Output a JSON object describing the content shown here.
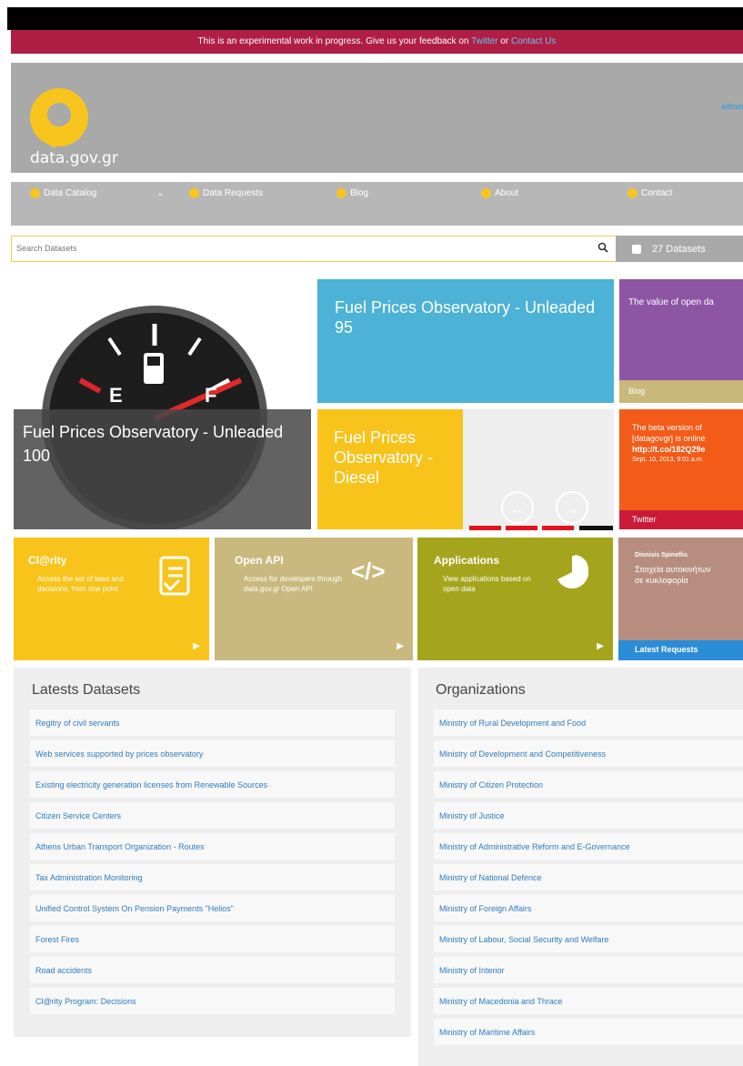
{
  "notice": {
    "prefix": "This is an experimental work in progress. Give us your feedback on ",
    "twitter": "Twitter",
    "or": " or ",
    "contact": "Contact Us"
  },
  "header": {
    "logo_text": "data.gov.gr",
    "admin": "admin"
  },
  "nav": {
    "items": [
      {
        "label": "Data Catalog"
      },
      {
        "label": "Data Requests"
      },
      {
        "label": "Blog"
      },
      {
        "label": "About"
      },
      {
        "label": "Contact"
      }
    ],
    "caret": "⌄"
  },
  "search": {
    "placeholder": "Search Datasets",
    "count_label": "27 Datasets"
  },
  "featured": {
    "fuel100": "Fuel Prices Observatory - Unleaded 100",
    "fuel95": "Fuel Prices Observatory - Unleaded 95",
    "diesel": "Fuel Prices Observatory - Diesel",
    "purple_text": "The value of open da",
    "blog_label": "Blog",
    "tweet_line1": "The beta version of",
    "tweet_line2": "[datagovgr] is online",
    "tweet_line3": "http://t.co/182Q29e",
    "tweet_date": "Sept. 10, 2013, 9:01 a.m.",
    "twitter_label": "Twitter",
    "gauge_e": "E",
    "gauge_f": "F"
  },
  "tiles": {
    "clarity": {
      "title": "Cl@rity",
      "desc": "Access the set of laws and decisions, from one point"
    },
    "openapi": {
      "title": "Open API",
      "desc": "Access for developers through data.gov.gr Open API"
    },
    "apps": {
      "title": "Applications",
      "desc": "View applications based on open data"
    },
    "spinel": {
      "author": "Dionisis Spinellis",
      "text": "Στοιχεία αυτοκινήτων σε κυκλοφορία"
    },
    "latest_requests": "Latest Requests"
  },
  "datasets": {
    "title": "Latests Datasets",
    "items": [
      "Regitry of civil servants",
      "Web services supported by prices observatory",
      "Existing electricity generation licenses from Renewable Sources",
      "Citizen Service Centers",
      "Athens Urban Transport Organization - Routes",
      "Tax Administration Monitoring",
      "Unified Control System On Pension Payments \"Helios\"",
      "Forest Fires",
      "Road accidents",
      "Cl@rity Program: Decisions"
    ]
  },
  "organizations": {
    "title": "Organizations",
    "items": [
      "Ministry of Rural Development and Food",
      "Ministry of Development and Competitiveness",
      "Ministry of Citizen Protection",
      "Ministry of Justice",
      "Ministry of Administrative Reform and E-Governance",
      "Ministry of National Defence",
      "Ministry of Foreign Affairs",
      "Ministry of Labour, Social Security and Welfare",
      "Ministry of Interior",
      "Ministry of Macedonia and Thrace",
      "Ministry of Maritime Affairs"
    ]
  },
  "colors": {
    "accent": "#f7c51e",
    "notice": "#b01e46",
    "link": "#2d7bbd"
  }
}
